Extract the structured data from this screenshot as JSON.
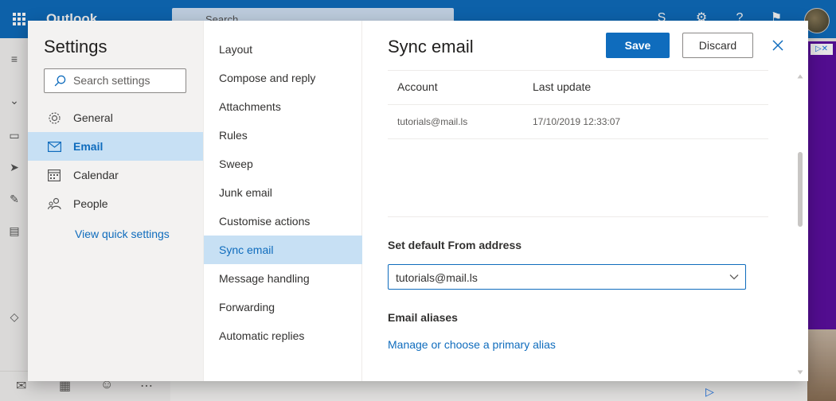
{
  "app": {
    "name": "Outlook",
    "search_placeholder": "Search"
  },
  "settings": {
    "title": "Settings",
    "search_placeholder": "Search settings",
    "categories": [
      {
        "label": "General",
        "icon": "gear-icon"
      },
      {
        "label": "Email",
        "icon": "mail-icon",
        "active": true
      },
      {
        "label": "Calendar",
        "icon": "calendar-icon"
      },
      {
        "label": "People",
        "icon": "people-icon"
      }
    ],
    "quick_settings_link": "View quick settings"
  },
  "email_subnav": [
    {
      "label": "Layout"
    },
    {
      "label": "Compose and reply"
    },
    {
      "label": "Attachments"
    },
    {
      "label": "Rules"
    },
    {
      "label": "Sweep"
    },
    {
      "label": "Junk email"
    },
    {
      "label": "Customise actions"
    },
    {
      "label": "Sync email",
      "active": true
    },
    {
      "label": "Message handling"
    },
    {
      "label": "Forwarding"
    },
    {
      "label": "Automatic replies"
    }
  ],
  "pane": {
    "title": "Sync email",
    "save_label": "Save",
    "discard_label": "Discard",
    "table": {
      "headers": [
        "Account",
        "Last update"
      ],
      "rows": [
        [
          "tutorials@mail.ls",
          "17/10/2019 12:33:07"
        ]
      ]
    },
    "default_from_label": "Set default From address",
    "default_from_value": "tutorials@mail.ls",
    "aliases_label": "Email aliases",
    "aliases_link": "Manage or choose a primary alias"
  },
  "ad": {
    "badge": "▷✕"
  },
  "colors": {
    "accent": "#0f6cbd",
    "selected_bg": "#c7e0f4",
    "nav_bg": "#f3f2f1"
  }
}
